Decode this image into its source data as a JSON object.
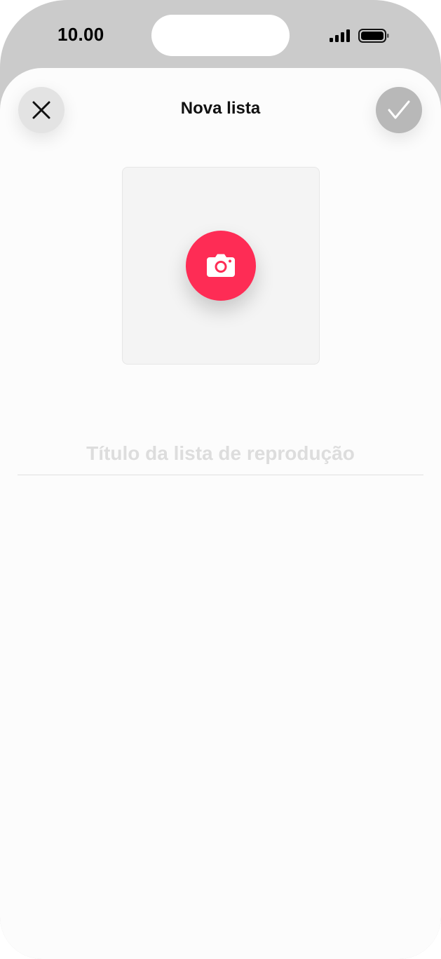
{
  "status_bar": {
    "time": "10.00"
  },
  "header": {
    "title": "Nova lista",
    "close_icon": "close-icon",
    "confirm_icon": "checkmark-icon"
  },
  "cover": {
    "icon": "camera-icon"
  },
  "title_field": {
    "placeholder": "Título da lista de reprodução",
    "value": ""
  },
  "colors": {
    "accent": "#fe2c55",
    "frame": "#cbcbcb",
    "sheet": "#fcfcfc",
    "placeholder": "#dddddd"
  }
}
